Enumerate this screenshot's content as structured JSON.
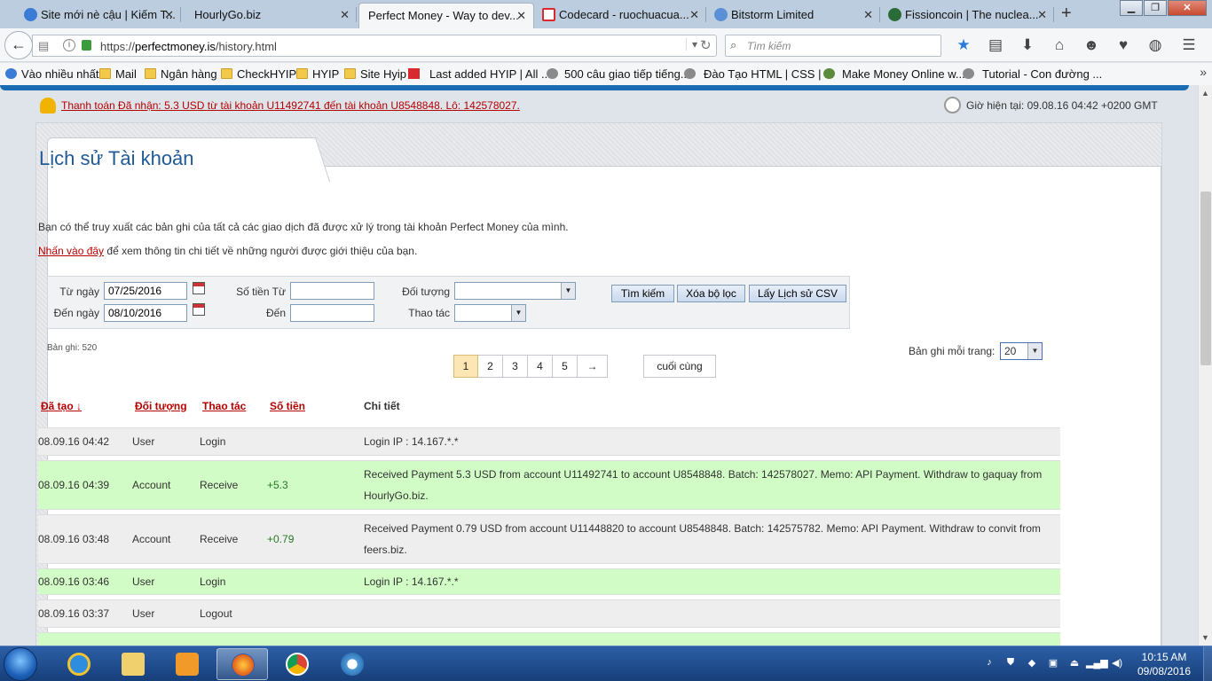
{
  "browser": {
    "tabs": [
      {
        "label": "Site mới nè cậu | Kiếm T...",
        "icon": "search-site-icon",
        "color": "#3a7bd5",
        "active": false
      },
      {
        "label": "HourlyGo.biz",
        "icon": "",
        "color": "",
        "active": false
      },
      {
        "label": "Perfect Money - Way to dev...",
        "icon": "",
        "color": "",
        "active": true
      },
      {
        "label": "Codecard - ruochuacua...",
        "icon": "gmail-icon",
        "color": "#d8292f",
        "active": false
      },
      {
        "label": "Bitstorm Limited",
        "icon": "bitstorm-icon",
        "color": "#5b8fd6",
        "active": false
      },
      {
        "label": "Fissioncoin | The nuclea...",
        "icon": "fission-icon",
        "color": "#2a6b3a",
        "active": false
      }
    ],
    "url_prefix": "https://",
    "url_domain": "perfectmoney.is",
    "url_path": "/history.html",
    "search_placeholder": "Tìm kiếm",
    "bookmarks": [
      {
        "label": "Vào nhiều nhất",
        "icon": "blue"
      },
      {
        "label": "Mail",
        "icon": "folder"
      },
      {
        "label": "Ngân hàng",
        "icon": "folder"
      },
      {
        "label": "CheckHYIP",
        "icon": "folder"
      },
      {
        "label": "HYIP",
        "icon": "folder"
      },
      {
        "label": "Site Hyip",
        "icon": "folder"
      },
      {
        "label": "Last added HYIP | All ...",
        "icon": "red"
      },
      {
        "label": "500 câu giao tiếp tiếng...",
        "icon": "globe"
      },
      {
        "label": "Đào Tạo HTML | CSS | ...",
        "icon": "globe"
      },
      {
        "label": "Make Money Online w...",
        "icon": "green"
      },
      {
        "label": "Tutorial - Con đường ...",
        "icon": "globe"
      }
    ]
  },
  "notice": {
    "text": "Thanh toán Đã nhận: 5.3 USD từ tài khoản U11492741 đến tài khoản U8548848. Lô: 142578027.",
    "time": "Giờ hiện tại: 09.08.16 04:42 +0200 GMT"
  },
  "page": {
    "title": "Lịch sử Tài khoản",
    "intro": "Bạn có thể truy xuất các bản ghi của tất cả các giao dịch đã được xử lý trong tài khoản Perfect Money của mình.",
    "referral_link": "Nhấn vào đây",
    "referral_text": " để xem thông tin chi tiết về những người được giới thiệu của bạn."
  },
  "filter": {
    "from_date_label": "Từ ngày",
    "from_date": "07/25/2016",
    "to_date_label": "Đến ngày",
    "to_date": "08/10/2016",
    "amount_from_label": "Số tiền Từ",
    "amount_to_label": "Đến",
    "object_label": "Đối tượng",
    "action_label": "Thao tác",
    "search_button": "Tìm kiếm",
    "clear_button": "Xóa bộ lọc",
    "csv_button": "Lấy Lịch sử CSV"
  },
  "records": {
    "count_label": "Bản ghi: 520",
    "pages": [
      "1",
      "2",
      "3",
      "4",
      "5"
    ],
    "next_label": "→",
    "last_label": "cuối cùng",
    "per_page_label": "Bản ghi mỗi trang:",
    "per_page_value": "20"
  },
  "table": {
    "headers": [
      "Đã tạo ↓",
      "Đối tượng",
      "Thao tác",
      "Số tiền",
      "Chi tiết"
    ],
    "rows": [
      {
        "date": "08.09.16 04:42",
        "object": "User",
        "action": "Login",
        "amount": "",
        "detail": "Login IP : 14.167.*.*",
        "style": "grey"
      },
      {
        "date": "08.09.16 04:39",
        "object": "Account",
        "action": "Receive",
        "amount": "+5.3",
        "detail": "Received Payment 5.3 USD from account U11492741 to account U8548848. Batch: 142578027. Memo: API Payment. Withdraw to gaquay from HourlyGo.biz.",
        "style": "green"
      },
      {
        "date": "08.09.16 03:48",
        "object": "Account",
        "action": "Receive",
        "amount": "+0.79",
        "detail": "Received Payment 0.79 USD from account U11448820 to account U8548848. Batch: 142575782. Memo: API Payment. Withdraw to convit from feers.biz.",
        "style": "grey"
      },
      {
        "date": "08.09.16 03:46",
        "object": "User",
        "action": "Login",
        "amount": "",
        "detail": "Login IP : 14.167.*.*",
        "style": "green"
      },
      {
        "date": "08.09.16 03:37",
        "object": "User",
        "action": "Logout",
        "amount": "",
        "detail": "",
        "style": "grey"
      },
      {
        "date": "",
        "object": "",
        "action": "",
        "amount": "",
        "detail": "",
        "style": "green"
      }
    ]
  },
  "taskbar": {
    "time": "10:15 AM",
    "date": "09/08/2016"
  },
  "colors": {
    "link_red": "#b50000",
    "title_blue": "#1f5a96",
    "row_green": "#d2fcc6",
    "row_grey": "#eeeeee",
    "amount_green": "#257a25"
  }
}
